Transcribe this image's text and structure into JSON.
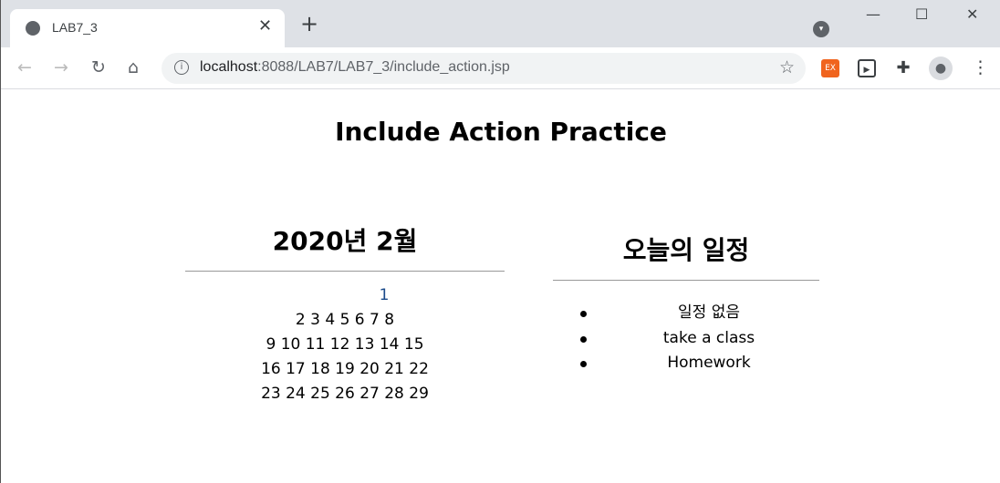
{
  "browser": {
    "tab_title": "LAB7_3",
    "url_host": "localhost",
    "url_rest": ":8088/LAB7/LAB7_3/include_action.jsp"
  },
  "page": {
    "title": "Include Action Practice",
    "calendar": {
      "heading": "2020년 2월",
      "weeks": [
        "1",
        "2 3 4 5 6 7 8",
        "9 10 11 12 13 14 15",
        "16 17 18 19 20 21 22",
        "23 24 25 26 27 28 29"
      ]
    },
    "schedule": {
      "heading": "오늘의 일정",
      "items": [
        "일정 없음",
        "take a class",
        "Homework"
      ]
    }
  }
}
